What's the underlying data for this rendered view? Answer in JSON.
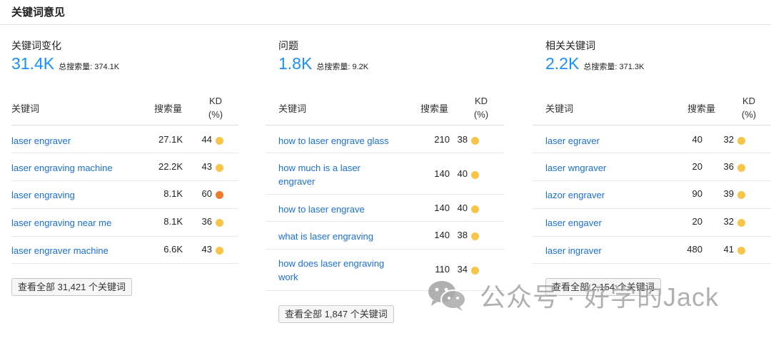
{
  "page": {
    "title": "关键词意见"
  },
  "colors": {
    "accent": "#1890ff",
    "link": "#1a6fd8",
    "kd_yellow": "#f7c548",
    "kd_orange": "#ef7a2c"
  },
  "columns": [
    {
      "label": "关键词变化",
      "total": "31.4K",
      "volume_label": "总搜索量:",
      "volume_value": "374.1K",
      "headers": {
        "keyword": "关键词",
        "volume": "搜索量",
        "kd_line1": "KD",
        "kd_line2": "(%)"
      },
      "rows": [
        {
          "keyword": "laser engraver",
          "volume": "27.1K",
          "kd": "44",
          "level": "yellow"
        },
        {
          "keyword": "laser engraving machine",
          "volume": "22.2K",
          "kd": "43",
          "level": "yellow"
        },
        {
          "keyword": "laser engraving",
          "volume": "8.1K",
          "kd": "60",
          "level": "orange"
        },
        {
          "keyword": "laser engraving near me",
          "volume": "8.1K",
          "kd": "36",
          "level": "yellow"
        },
        {
          "keyword": "laser engraver machine",
          "volume": "6.6K",
          "kd": "43",
          "level": "yellow"
        }
      ],
      "view_all": "查看全部 31,421 个关键词"
    },
    {
      "label": "问题",
      "total": "1.8K",
      "volume_label": "总搜索量:",
      "volume_value": "9.2K",
      "headers": {
        "keyword": "关键词",
        "volume": "搜索量",
        "kd_line1": "KD",
        "kd_line2": "(%)"
      },
      "rows": [
        {
          "keyword_line1": "how to laser engrave glass",
          "keyword_line2": "",
          "volume": "210",
          "kd": "38",
          "level": "yellow"
        },
        {
          "keyword_line1": "how much is a laser",
          "keyword_line2": "engraver",
          "volume": "140",
          "kd": "40",
          "level": "yellow"
        },
        {
          "keyword_line1": "how to laser engrave",
          "keyword_line2": "",
          "volume": "140",
          "kd": "40",
          "level": "yellow"
        },
        {
          "keyword_line1": "what is laser engraving",
          "keyword_line2": "",
          "volume": "140",
          "kd": "38",
          "level": "yellow"
        },
        {
          "keyword_line1": "how does laser engraving",
          "keyword_line2": "work",
          "volume": "110",
          "kd": "34",
          "level": "yellow"
        }
      ],
      "view_all": "查看全部 1,847 个关键词"
    },
    {
      "label": "相关关键词",
      "total": "2.2K",
      "volume_label": "总搜索量:",
      "volume_value": "371.3K",
      "headers": {
        "keyword": "关键词",
        "volume": "搜索量",
        "kd_line1": "KD",
        "kd_line2": "(%)"
      },
      "rows": [
        {
          "keyword": "laser egraver",
          "volume": "40",
          "kd": "32",
          "level": "yellow"
        },
        {
          "keyword": "laser wngraver",
          "volume": "20",
          "kd": "36",
          "level": "yellow"
        },
        {
          "keyword": "lazor engraver",
          "volume": "90",
          "kd": "39",
          "level": "yellow"
        },
        {
          "keyword": "laser engaver",
          "volume": "20",
          "kd": "32",
          "level": "yellow"
        },
        {
          "keyword": "laser ingraver",
          "volume": "480",
          "kd": "41",
          "level": "yellow"
        }
      ],
      "view_all": "查看全部 2,154 个关键词"
    }
  ],
  "watermark": {
    "text": "公众号 · 好学的Jack",
    "icon": "wechat-icon"
  }
}
